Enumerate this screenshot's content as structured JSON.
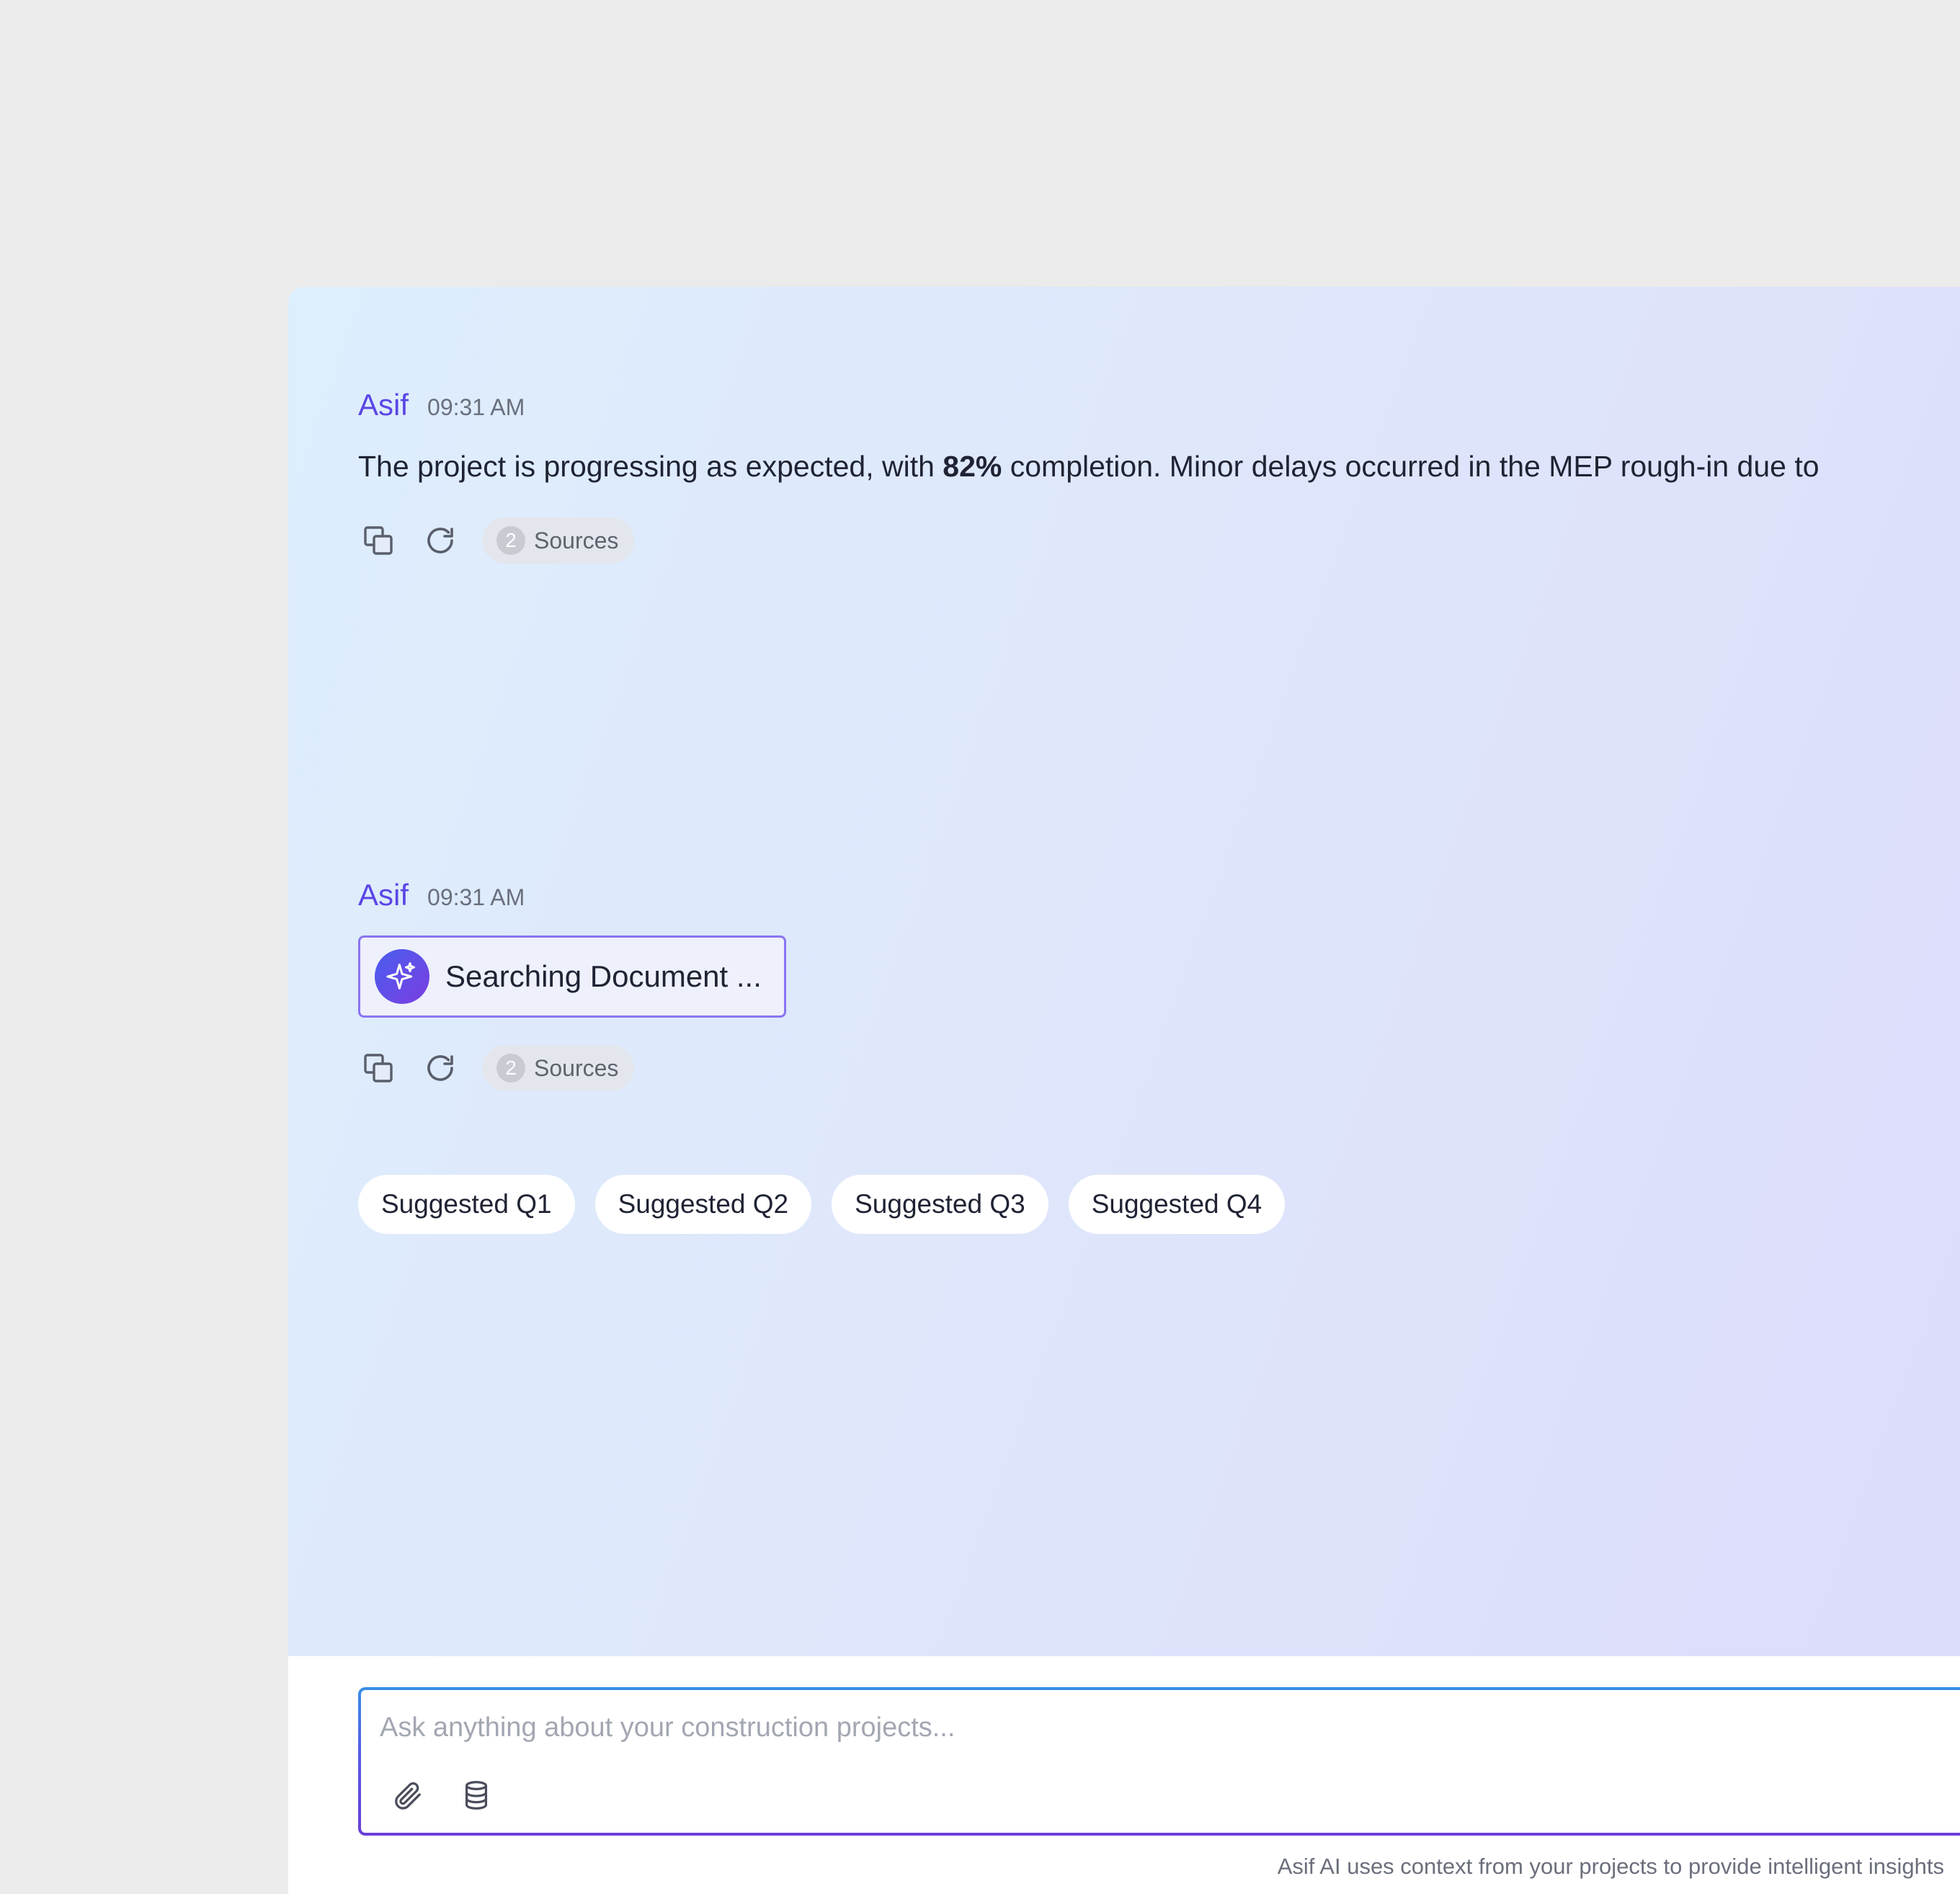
{
  "messages": [
    {
      "author": "Asif",
      "time": "09:31 AM",
      "text_before": "The project is progressing as expected, with ",
      "text_strong": "82%",
      "text_after": " completion. Minor delays occurred in the MEP rough-in due to",
      "sources_count": "2",
      "sources_label": "Sources"
    },
    {
      "author": "Asif",
      "time": "09:31 AM",
      "status_text": "Searching Document ...",
      "sources_count": "2",
      "sources_label": "Sources"
    }
  ],
  "suggestions": [
    "Suggested Q1",
    "Suggested Q2",
    "Suggested Q3",
    "Suggested Q4"
  ],
  "composer": {
    "placeholder": "Ask anything about your construction projects...",
    "value": ""
  },
  "footnote": "Asif AI uses context from your projects to provide intelligent insights",
  "icons": {
    "copy": "copy-icon",
    "regenerate": "refresh-icon",
    "ai": "sparkle-icon",
    "attach": "paperclip-icon",
    "data": "database-icon"
  },
  "colors": {
    "accent": "#5b46e6",
    "text": "#1f2333",
    "muted": "#6b6f7c"
  }
}
